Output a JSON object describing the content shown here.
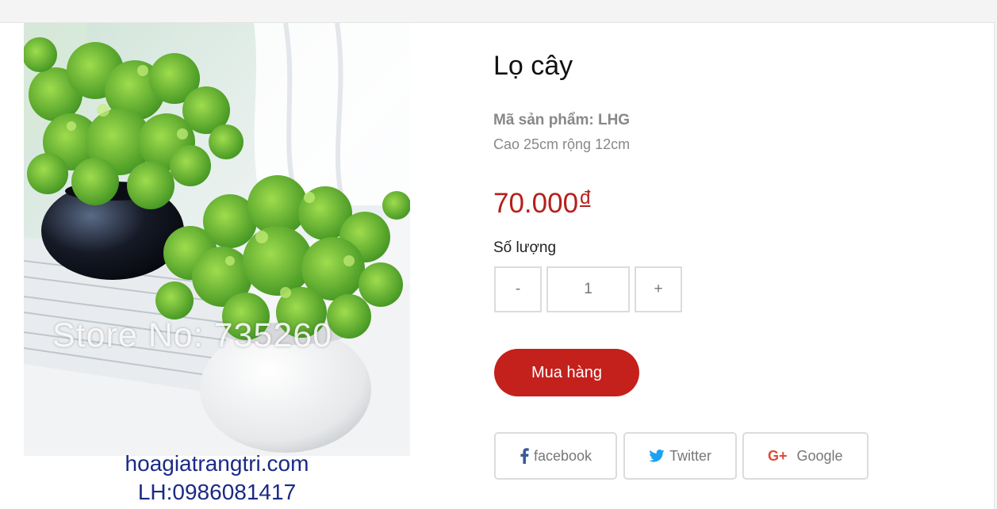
{
  "image": {
    "alt": "",
    "watermark": "Store No: 735260",
    "site": "hoagiatrangtri.com",
    "phone": "LH:0986081417"
  },
  "product": {
    "title": "Lọ cây",
    "sku": "Mã sản phẩm: LHG",
    "size": "Cao 25cm rộng 12cm",
    "price": "70.000",
    "currency": "đ"
  },
  "quantity": {
    "label": "Số lượng",
    "minus": "-",
    "value": "1",
    "plus": "+"
  },
  "buy_label": "Mua hàng",
  "share": {
    "facebook": "facebook",
    "twitter": "Twitter",
    "google": "Google"
  },
  "icons": {
    "facebook": "facebook-icon",
    "twitter": "twitter-bird-icon",
    "google": "google-plus-icon"
  },
  "colors": {
    "price": "#b5201b",
    "buy_button": "#c4201c",
    "facebook": "#3b5998",
    "twitter": "#1da1f2",
    "google": "#dd4b39"
  }
}
